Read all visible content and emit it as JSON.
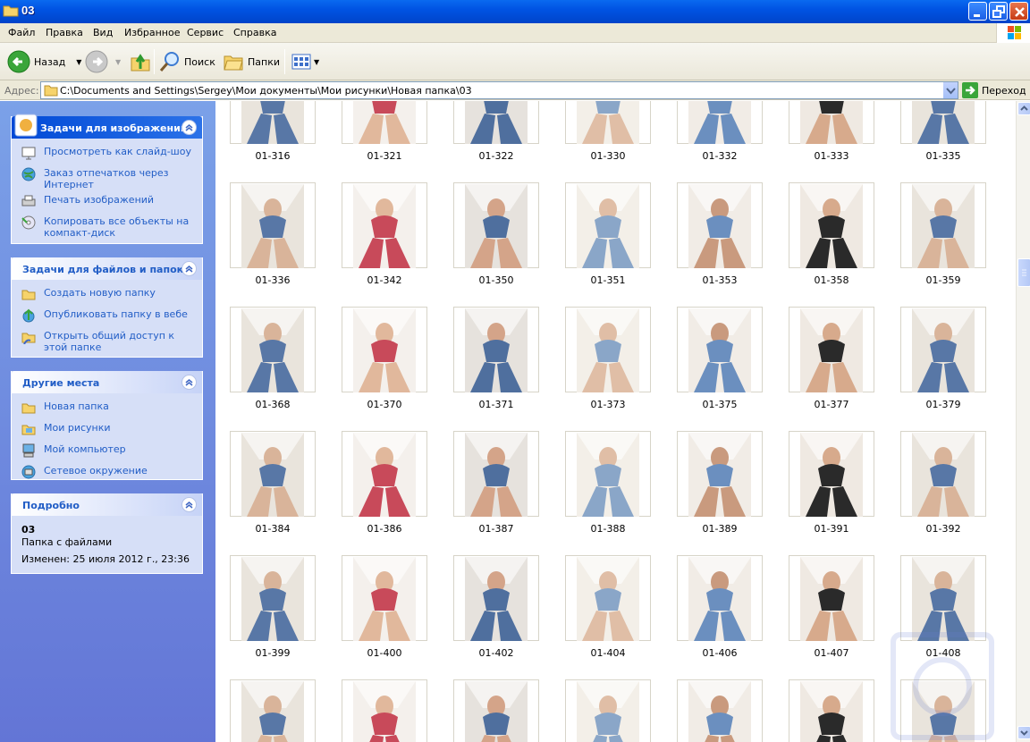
{
  "window": {
    "title": "03"
  },
  "menu": [
    "Файл",
    "Правка",
    "Вид",
    "Избранное",
    "Сервис",
    "Справка"
  ],
  "toolbar": {
    "back": "Назад",
    "search": "Поиск",
    "folders": "Папки"
  },
  "address": {
    "label": "Адрес:",
    "path": "C:\\Documents and Settings\\Sergey\\Мои документы\\Мои рисунки\\Новая папка\\03",
    "go": "Переход"
  },
  "sidebar": {
    "image_tasks": {
      "title": "Задачи для изображений",
      "items": [
        "Просмотреть как слайд-шоу",
        "Заказ отпечатков через Интернет",
        "Печать изображений",
        "Копировать все объекты на компакт-диск"
      ]
    },
    "file_tasks": {
      "title": "Задачи для файлов и папок",
      "items": [
        "Создать новую папку",
        "Опубликовать папку в вебе",
        "Открыть общий доступ к этой папке"
      ]
    },
    "other_places": {
      "title": "Другие места",
      "items": [
        "Новая папка",
        "Мои рисунки",
        "Мой компьютер",
        "Сетевое окружение"
      ]
    },
    "details": {
      "title": "Подробно",
      "name": "03",
      "type": "Папка с файлами",
      "modified": "Изменен: 25 июля 2012 г., 23:36"
    }
  },
  "files": [
    "01-316",
    "01-321",
    "01-322",
    "01-330",
    "01-332",
    "01-333",
    "01-335",
    "01-336",
    "01-342",
    "01-350",
    "01-351",
    "01-353",
    "01-358",
    "01-359",
    "01-368",
    "01-370",
    "01-371",
    "01-373",
    "01-375",
    "01-377",
    "01-379",
    "01-384",
    "01-386",
    "01-387",
    "01-388",
    "01-389",
    "01-391",
    "01-392",
    "01-399",
    "01-400",
    "01-402",
    "01-404",
    "01-406",
    "01-407",
    "01-408",
    "",
    "",
    "",
    "",
    "",
    "",
    ""
  ],
  "colors": {
    "titlebar": "#0053e3",
    "sidebar": "#6f8ddf",
    "link": "#215dc6"
  }
}
